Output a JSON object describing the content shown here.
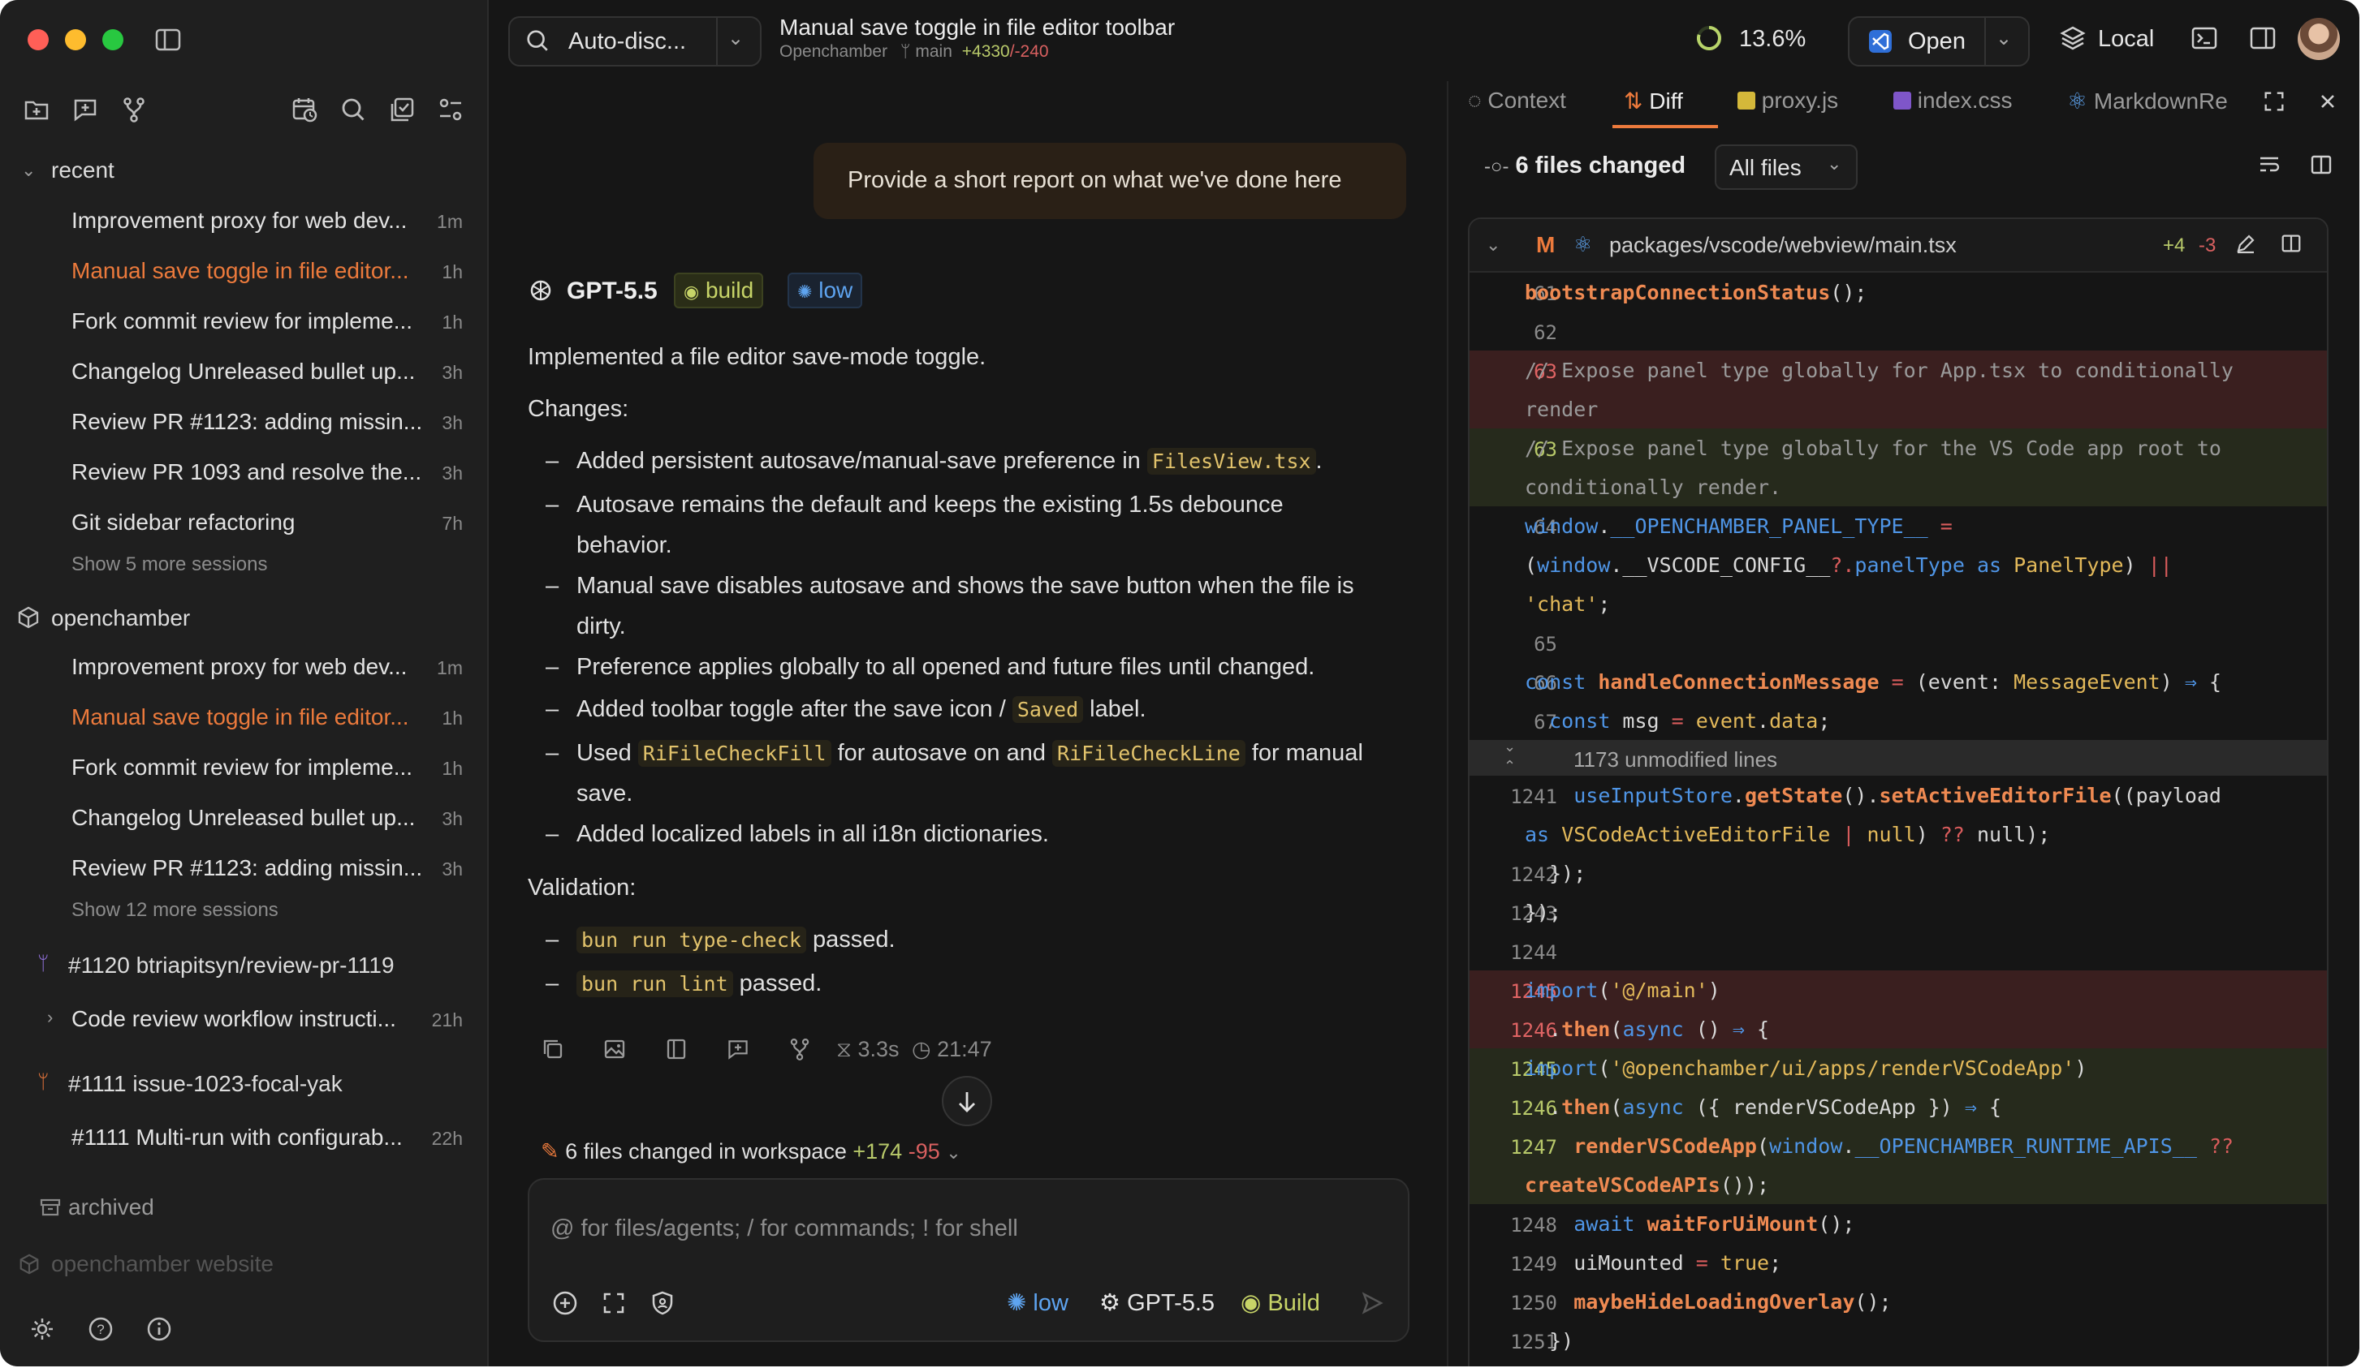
{
  "sidebar": {
    "recent_label": "recent",
    "recent": [
      {
        "title": "Improvement proxy for web dev...",
        "time": "1m",
        "active": false
      },
      {
        "title": "Manual save toggle in file editor...",
        "time": "1h",
        "active": true
      },
      {
        "title": "Fork commit review for impleme...",
        "time": "1h",
        "active": false
      },
      {
        "title": "Changelog Unreleased bullet up...",
        "time": "3h",
        "active": false
      },
      {
        "title": "Review PR #1123: adding missin...",
        "time": "3h",
        "active": false
      },
      {
        "title": "Review PR 1093 and resolve the...",
        "time": "3h",
        "active": false
      },
      {
        "title": "Git sidebar refactoring",
        "time": "7h",
        "active": false
      }
    ],
    "recent_more": "Show 5 more sessions",
    "project_label": "openchamber",
    "project": [
      {
        "title": "Improvement proxy for web dev...",
        "time": "1m",
        "active": false
      },
      {
        "title": "Manual save toggle in file editor...",
        "time": "1h",
        "active": true
      },
      {
        "title": "Fork commit review for impleme...",
        "time": "1h",
        "active": false
      },
      {
        "title": "Changelog Unreleased bullet up...",
        "time": "3h",
        "active": false
      },
      {
        "title": "Review PR #1123: adding missin...",
        "time": "3h",
        "active": false
      }
    ],
    "project_more": "Show 12 more sessions",
    "worktree1": "#1120 btriapitsyn/review-pr-1119",
    "worktree1_item": {
      "title": "Code review workflow instructi...",
      "time": "21h"
    },
    "worktree2": "#1111 issue-1023-focal-yak",
    "worktree2_item": {
      "title": "#1111 Multi-run with configurab...",
      "time": "22h"
    },
    "archived": "archived",
    "project2": "openchamber website"
  },
  "header": {
    "agent_select": "Auto-disc...",
    "title": "Manual save toggle in file editor toolbar",
    "project": "Openchamber",
    "branch": "main",
    "additions": "+4330",
    "deletions": "/-240",
    "context_percent": "13.6%",
    "open_label": "Open",
    "local_label": "Local"
  },
  "chat": {
    "user_message": "Provide a short report on what we've done here",
    "model": "GPT-5.5",
    "agent_badge": "build",
    "effort_badge": "low",
    "intro": "Implemented a file editor save-mode toggle.",
    "changes_heading": "Changes:",
    "changes": [
      {
        "pre": "Added persistent autosave/manual-save preference in ",
        "code": "FilesView.tsx",
        "post": "."
      },
      {
        "line1": "Autosave remains the default and keeps the existing 1.5s debounce",
        "line2": "behavior."
      },
      {
        "line1": "Manual save disables autosave and shows the save button when the file is",
        "line2": "dirty."
      },
      {
        "text": "Preference applies globally to all opened and future files until changed."
      },
      {
        "pre": "Added toolbar toggle after the save icon / ",
        "code": "Saved",
        "post": " label."
      },
      {
        "pre": "Used ",
        "code": "RiFileCheckFill",
        "mid": " for autosave on and ",
        "code2": "RiFileCheckLine",
        "post": " for manual",
        "line2": "save."
      },
      {
        "text": "Added localized labels in all i18n dictionaries."
      }
    ],
    "validation_heading": "Validation:",
    "validation": [
      {
        "code": "bun run type-check",
        "post": " passed."
      },
      {
        "code": "bun run lint",
        "post": " passed."
      }
    ],
    "duration": "3.3s",
    "clock": "21:47",
    "files_changed": "6 files changed in workspace",
    "files_add": "+174",
    "files_del": "-95",
    "composer_placeholder": "@ for files/agents; / for commands; ! for shell",
    "composer_effort": "low",
    "composer_model": "GPT-5.5",
    "composer_agent": "Build"
  },
  "diff": {
    "tabs": [
      "Context",
      "Diff",
      "proxy.js",
      "index.css",
      "MarkdownRe"
    ],
    "files_changed": "6 files changed",
    "filter": "All files",
    "file_status": "M",
    "file_path": "packages/vscode/webview/main.tsx",
    "file_add": "+4",
    "file_del": "-3",
    "unmodified": "1173 unmodified lines",
    "lines": [
      {
        "n": "61",
        "k": "ctx",
        "c": "<span class='fn'>bootstrapConnectionStatus</span>();"
      },
      {
        "n": "62",
        "k": "ctx",
        "c": ""
      },
      {
        "n": "63",
        "k": "del",
        "c": "<span class='cm'>// Expose panel type globally for App.tsx to conditionally</span>"
      },
      {
        "n": "",
        "k": "del",
        "c": "<span class='cm'>render</span>"
      },
      {
        "n": "63",
        "k": "add",
        "c": "<span class='cm'>// Expose panel type globally for the VS Code app root to</span>"
      },
      {
        "n": "",
        "k": "add",
        "c": "<span class='cm'>conditionally render.</span>"
      },
      {
        "n": "64",
        "k": "ctx",
        "c": "<span class='kw'>window</span>.<span class='kw'>__OPENCHAMBER_PANEL_TYPE__</span> <span class='op'>=</span>"
      },
      {
        "n": "",
        "k": "ctx",
        "c": "(<span class='kw'>window</span>.__VSCODE_CONFIG__<span class='op'>?.</span><span class='kw'>panelType</span> <span class='kw'>as</span> <span class='ty'>PanelType</span>) <span class='op'>||</span>"
      },
      {
        "n": "",
        "k": "ctx",
        "c": "<span class='str'>'chat'</span>;"
      },
      {
        "n": "65",
        "k": "ctx",
        "c": ""
      },
      {
        "n": "66",
        "k": "ctx",
        "c": "<span class='kw'>const</span> <span class='fn'>handleConnectionMessage</span> <span class='op'>=</span> (event: <span class='ty'>MessageEvent</span>) <span class='kw'>⇒</span> {"
      },
      {
        "n": "67",
        "k": "ctx",
        "c": "  <span class='kw'>const</span> msg <span class='op'>=</span> <span class='ty'>event</span>.<span class='ty'>data</span>;"
      },
      {
        "n": "1241",
        "k": "ctx",
        "c": "    <span class='kw'>useInputStore</span>.<span class='fn'>getState</span>().<span class='fn'>setActiveEditorFile</span>((payload"
      },
      {
        "n": "",
        "k": "ctx",
        "c": "<span class='kw'>as</span> <span class='ty'>VSCodeActiveEditorFile</span> <span class='op'>|</span> <span class='ty'>null</span>) <span class='op'>??</span> null);"
      },
      {
        "n": "1242",
        "k": "ctx",
        "c": "  });"
      },
      {
        "n": "1243",
        "k": "ctx",
        "c": "});"
      },
      {
        "n": "1244",
        "k": "ctx",
        "c": ""
      },
      {
        "n": "1245",
        "k": "del",
        "c": "<span class='kw'>import</span>(<span class='str'>'@/main'</span>)"
      },
      {
        "n": "1246",
        "k": "del",
        "c": "  .<span class='fn'>then</span>(<span class='kw'>async</span> () <span class='kw'>⇒</span> {"
      },
      {
        "n": "1245",
        "k": "add",
        "c": "<span class='kw'>import</span>(<span class='str'>'@openchamber/ui/apps/renderVSCodeApp'</span>)"
      },
      {
        "n": "1246",
        "k": "add",
        "c": "  .<span class='fn'>then</span>(<span class='kw'>async</span> ({ renderVSCodeApp }) <span class='kw'>⇒</span> {"
      },
      {
        "n": "1247",
        "k": "add",
        "c": "    <span class='fn'>renderVSCodeApp</span>(<span class='kw'>window</span>.<span class='kw'>__OPENCHAMBER_RUNTIME_APIS__</span> <span class='op'>??</span>"
      },
      {
        "n": "",
        "k": "add",
        "c": "<span class='fn'>createVSCodeAPIs</span>());"
      },
      {
        "n": "1248",
        "k": "ctx",
        "c": "    <span class='kw'>await</span> <span class='fn'>waitForUiMount</span>();"
      },
      {
        "n": "1249",
        "k": "ctx",
        "c": "    uiMounted <span class='op'>=</span> <span class='ty'>true</span>;"
      },
      {
        "n": "1250",
        "k": "ctx",
        "c": "    <span class='fn'>maybeHideLoadingOverlay</span>();"
      },
      {
        "n": "1251",
        "k": "ctx",
        "c": "  })"
      }
    ]
  }
}
